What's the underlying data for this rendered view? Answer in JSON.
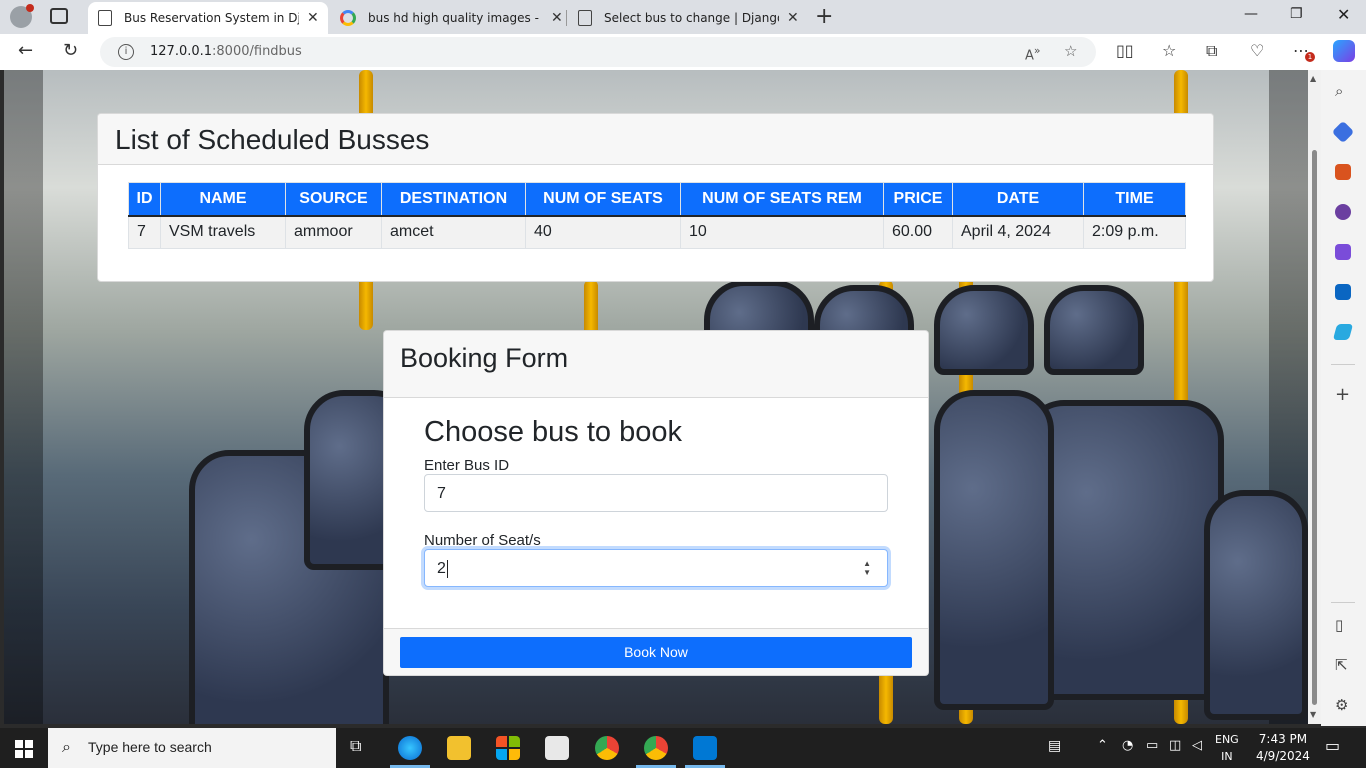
{
  "browser": {
    "tabs": [
      {
        "title": "Bus Reservation System in Djang",
        "active": true
      },
      {
        "title": "bus hd high quality images - Goo",
        "active": false
      },
      {
        "title": "Select bus to change | Django sit",
        "active": false
      }
    ],
    "url_host": "127.0.0.1",
    "url_path": ":8000/findbus",
    "notification_count": "1"
  },
  "list_card": {
    "title": "List of Scheduled Busses",
    "columns": [
      "ID",
      "NAME",
      "SOURCE",
      "DESTINATION",
      "NUM OF SEATS",
      "NUM OF SEATS REM",
      "PRICE",
      "DATE",
      "TIME"
    ],
    "rows": [
      [
        "7",
        "VSM travels",
        "ammoor",
        "amcet",
        "40",
        "10",
        "60.00",
        "April 4, 2024",
        "2:09 p.m."
      ]
    ]
  },
  "booking_form": {
    "header": "Booking Form",
    "title": "Choose bus to book",
    "bus_id_label": "Enter Bus ID",
    "bus_id_value": "7",
    "seats_label": "Number of Seat/s",
    "seats_value": "2",
    "submit_label": "Book Now"
  },
  "taskbar": {
    "search_placeholder": "Type here to search",
    "lang_top": "ENG",
    "lang_bottom": "IN",
    "time": "7:43 PM",
    "date": "4/9/2024"
  },
  "colors": {
    "primary": "#0d6efd",
    "header_bg": "#f7f7f7"
  }
}
